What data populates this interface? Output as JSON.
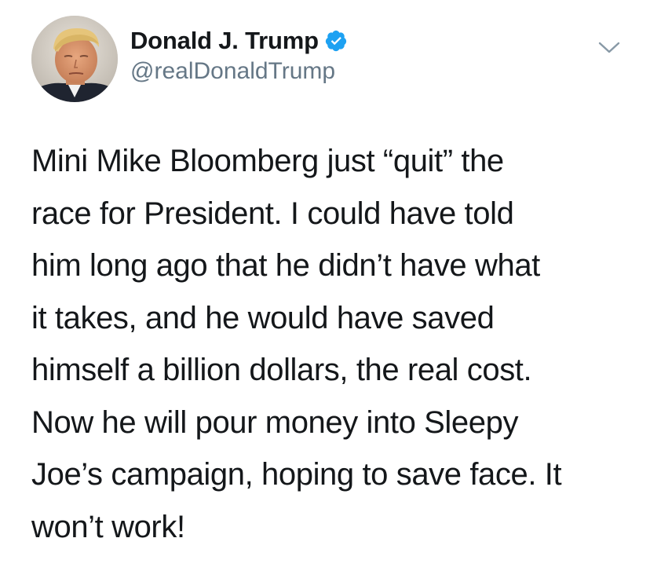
{
  "author": {
    "display_name": "Donald J. Trump",
    "handle": "@realDonaldTrump",
    "verified": true
  },
  "icons": {
    "avatar": "profile-photo",
    "verified": "verified-badge-icon",
    "menu": "chevron-down-icon"
  },
  "colors": {
    "verified_blue": "#1da1f2",
    "handle_gray": "#657786",
    "text": "#14171a",
    "chevron_gray": "#8899a6"
  },
  "tweet": {
    "lines": [
      "Mini Mike Bloomberg just “quit” the",
      "race for President. I could have told",
      "him long ago that he didn’t have what",
      "it takes, and he would have saved",
      "himself a billion dollars, the real cost.",
      "Now he will pour money into Sleepy",
      "Joe’s campaign, hoping to save face. It",
      "won’t work!"
    ]
  }
}
